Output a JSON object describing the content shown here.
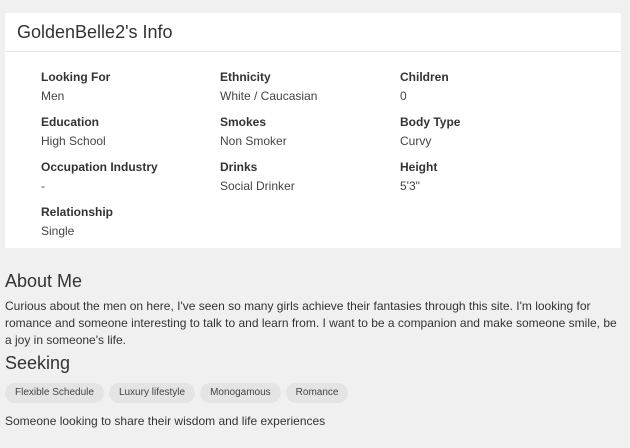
{
  "info": {
    "title": "GoldenBelle2's Info",
    "fields": [
      {
        "label": "Looking For",
        "value": "Men"
      },
      {
        "label": "Ethnicity",
        "value": "White / Caucasian"
      },
      {
        "label": "Children",
        "value": "0"
      },
      {
        "label": "Education",
        "value": "High School"
      },
      {
        "label": "Smokes",
        "value": "Non Smoker"
      },
      {
        "label": "Body Type",
        "value": "Curvy"
      },
      {
        "label": "Occupation Industry",
        "value": "-"
      },
      {
        "label": "Drinks",
        "value": "Social Drinker"
      },
      {
        "label": "Height",
        "value": "5'3\""
      },
      {
        "label": "Relationship",
        "value": "Single"
      }
    ]
  },
  "about": {
    "title": "About Me",
    "text": "Curious about the men on here, I've seen so many girls achieve their fantasies through this site. I'm looking for romance and someone interesting to talk to and learn from. I want to be a companion and make someone smile, be a joy in someone's life."
  },
  "seeking": {
    "title": "Seeking",
    "tags": [
      "Flexible Schedule",
      "Luxury lifestyle",
      "Monogamous",
      "Romance"
    ],
    "text": "Someone looking to share their wisdom and life experiences"
  }
}
